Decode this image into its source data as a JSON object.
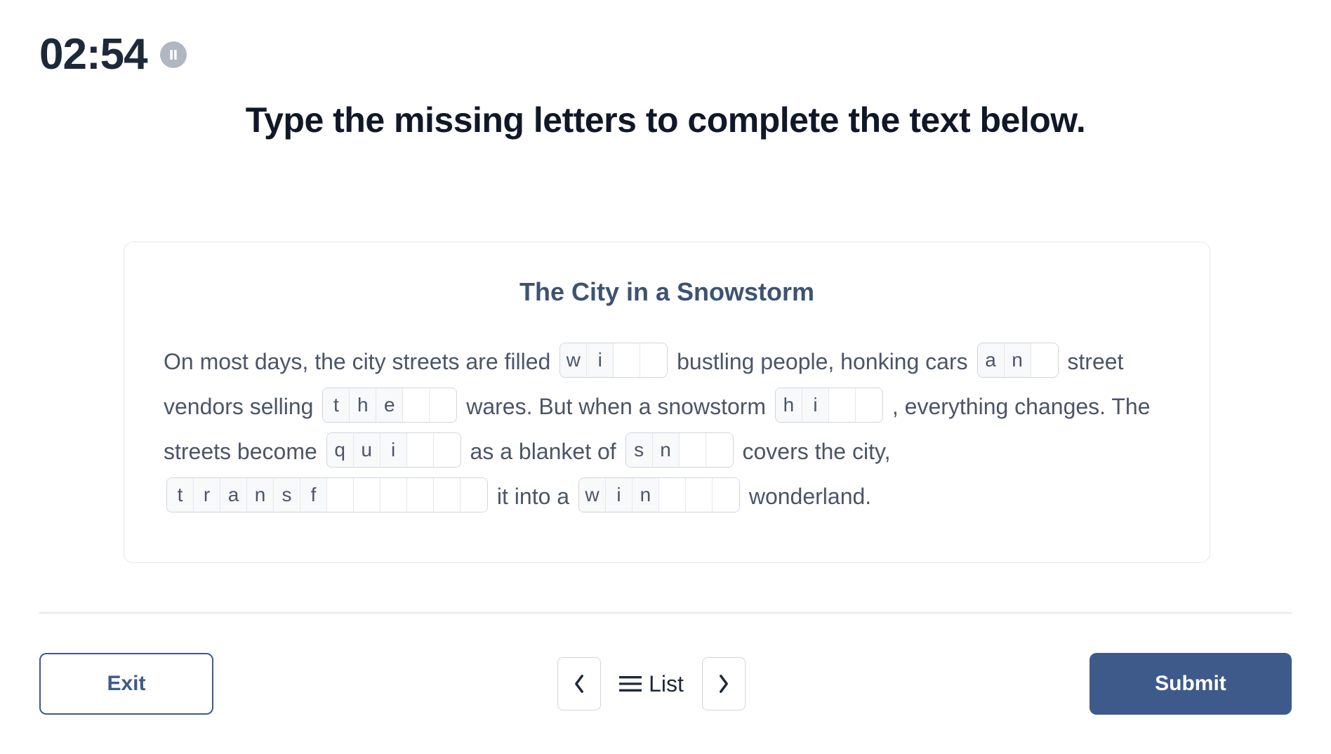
{
  "timer": {
    "display": "02:54"
  },
  "instruction": "Type the missing letters to complete the text below.",
  "card": {
    "title": "The City in a Snowstorm",
    "segments": [
      {
        "type": "text",
        "value": "On most days, the city streets are filled "
      },
      {
        "type": "word",
        "filled": [
          "w",
          "i"
        ],
        "blanks": 2
      },
      {
        "type": "text",
        "value": "  bustling people, honking cars "
      },
      {
        "type": "word",
        "filled": [
          "a",
          "n"
        ],
        "blanks": 1
      },
      {
        "type": "text",
        "value": "  street vendors selling "
      },
      {
        "type": "word",
        "filled": [
          "t",
          "h",
          "e"
        ],
        "blanks": 2
      },
      {
        "type": "text",
        "value": "  wares. But when a snowstorm "
      },
      {
        "type": "word",
        "filled": [
          "h",
          "i"
        ],
        "blanks": 2
      },
      {
        "type": "text",
        "value": " ,   everything changes. The streets become "
      },
      {
        "type": "word",
        "filled": [
          "q",
          "u",
          "i"
        ],
        "blanks": 2
      },
      {
        "type": "text",
        "value": "  as a blanket of "
      },
      {
        "type": "word",
        "filled": [
          "s",
          "n"
        ],
        "blanks": 2
      },
      {
        "type": "text",
        "value": "  covers the city, "
      },
      {
        "type": "word",
        "filled": [
          "t",
          "r",
          "a",
          "n",
          "s",
          "f"
        ],
        "blanks": 6
      },
      {
        "type": "text",
        "value": "  it into a "
      },
      {
        "type": "word",
        "filled": [
          "w",
          "i",
          "n"
        ],
        "blanks": 3
      },
      {
        "type": "text",
        "value": "  wonderland."
      }
    ]
  },
  "footer": {
    "exit_label": "Exit",
    "list_label": "List",
    "submit_label": "Submit"
  }
}
